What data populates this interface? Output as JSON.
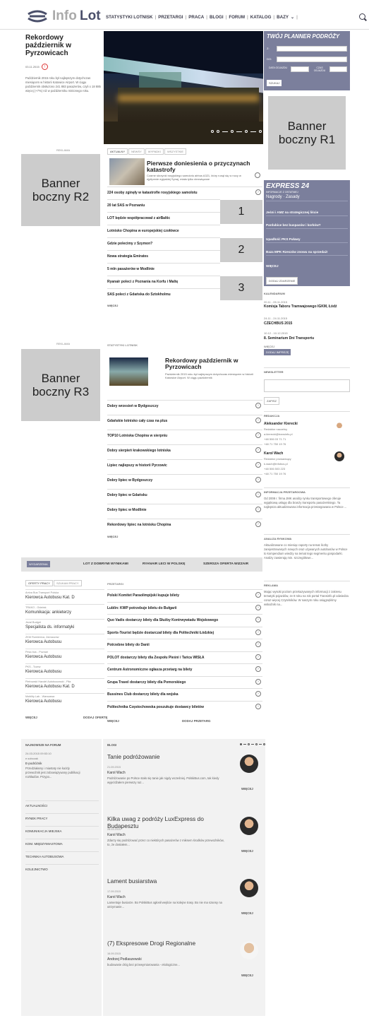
{
  "header": {
    "logo_info": "Info",
    "logo_lot": "Lot",
    "nav": [
      "STATYSTYKI LOTNISK",
      "PRZETARGI",
      "PRACA",
      "BLOGI",
      "FORUM",
      "KATALOG",
      "BAZY"
    ]
  },
  "featured": {
    "title": "Rekordowy październik w Pyrzowicach",
    "date": "03.11.2015",
    "excerpt": "Październik 2015 roku był najlepszym dotychczas miesiącem w historii Katowice Airport. W ciągu październik obsłużono 241 883 pasażerów, czyli o 18 885 więcej (+7%) niż w październiku minionego roku."
  },
  "planner": {
    "title": "TWÓJ PLANNER PODRÓŻY",
    "z": "Z:",
    "do": "DO:",
    "data_odj": "DATA ODJAZDU",
    "czas_odj": "CZAS ODJAZDU",
    "szukaj": "SZUKAJ"
  },
  "banners": {
    "r1": "Banner boczny R1",
    "r2": "Banner boczny R2",
    "r3": "Banner boczny R3",
    "reklama": "REKLAMA"
  },
  "news": {
    "tabs": [
      "AKTUALNY",
      "NEWSY",
      "WYPADKI",
      "WSZYSTKIE"
    ],
    "lead_title": "Pierwsze doniesienia o przyczynach katastrofy",
    "lead_ex": "Czarne skrzynki rosyjskiego samolotu airbus A321, który runął się w nocy w ejpitpenie egipskiej Synaj, miała tylko niezwiązane",
    "items": [
      "224 osoby zginęły w katastrofie rosyjskiego samolotu",
      "20 lat SAS w Poznaniu",
      "LOT będzie współpracował z airBaltic",
      "Lotnisko Chopina w europejskiej czołówce",
      "Gdzie polecimy z Szymon?",
      "Nowa strategia Emirates",
      "5 mln pasażerów w Modlinie",
      "Ryanair poleci z Poznania na Korfu i Maltę",
      "SAS poleci z Gdańska do Sztokholmu"
    ],
    "more": "WIĘCEJ",
    "nums": [
      "1",
      "2",
      "3"
    ]
  },
  "stats": {
    "label": "STATYSTYKI LOTNISK",
    "lead_title": "Rekordowy październik w Pyrzowicach",
    "lead_ex": "Październik 2015 roku był najlepszym dotychczas miesiącem w historii Katowice Airport. W ciągu październik",
    "items": [
      "Dobry wrzesień w Bydgoszczy",
      "Gdańskie lotnisko cały czas na plus",
      "TOP10 Lotniska Chopina w sierpniu",
      "Dobry sierpień krakowskiego lotniska",
      "Lipiec najlepszy w historii Pyrzowic",
      "Dobry lipiec w Bydgoszczy",
      "Dobry lipiec w Gdańsku",
      "Dobry lipiec w Modlinie",
      "Rekordowy lipiec na lotnisku Chopina"
    ],
    "more": "WIĘCEJ"
  },
  "express": {
    "title": "EXPRESS 24",
    "sub": "INFORMACJE Z OSTATNIEJ",
    "items": [
      "Nagrody · Zasady",
      "Jeśni i AMZ na strategicznej liście",
      "Pardubice bez buspasów i korków?",
      "Upadłość PKS Puławy",
      "Baza MPK Rzeszów znowu na sprzedaż!"
    ],
    "more": "WIĘCEJ",
    "add": "DODAJ ZDARZENIE"
  },
  "calendar": {
    "label": "KALENDARIUM",
    "events": [
      {
        "date": "20.11 - 05.11.2015",
        "name": "Komisja Taboru Tramwajowego IGKM, Łódź"
      },
      {
        "date": "24.11 - 24.11.2015",
        "name": "CZECHBUS 2015"
      },
      {
        "date": "10.12 - 10.12.2015",
        "name": "8. Seminarium Dni Transportu"
      }
    ],
    "more": "WIĘCEJ",
    "add": "DODAJ IMPREZĘ"
  },
  "newsletter": {
    "label": "NEWSLETTER",
    "btn": "ZAPISZ"
  },
  "redakcja": {
    "label": "REDAKCJA",
    "people": [
      {
        "name": "Aleksander Kierecki",
        "role": "Redaktor naczelny",
        "mail": "a.kierecki@transinfo.pl",
        "tel1": "+48 506 03 71 71",
        "tel2": "+48 71 750 19 76"
      },
      {
        "name": "Karol Wach",
        "role": "Redaktor prowadzący",
        "mail": "k.wach@infobus.pl",
        "tel1": "+48 506 503 223",
        "tel2": "+48 71 750 19 76"
      }
    ]
  },
  "info_przetarg": {
    "label": "INFORMACJA PRZETARGOWA",
    "text": "Od 2008 r. firma JMK analizy rynku transportowego oferuje wyjątkową usługę dla branży transportu pasażerskiego. Ta najlepsza aktualizowana informacja przetargowana w Polsce ..."
  },
  "analiza": {
    "label": "ANALIZA RYNKOWA",
    "text": "Aktualizowane co miesiąc raporty na temat liczby zarejestrowanych nowych oraz używanych autobusów w Polsce to kompendium wiedzy na temat tego segmentu gospodarki. Analizy zawierają min. szczegółowe..."
  },
  "reklama": {
    "label": "REKLAMA",
    "text": "Mając wysoki poziom przekazywanych informacji z zakresu tematyki pojazdów, ze 8 roku na rok portal Transinfo.pl odwiedza coraz więcej Czytelników. W naszym roku osiągnęliśmy wskaźnik na..."
  },
  "events_bar": {
    "label": "WYDARZENIA",
    "items": [
      "LOT Z DOBRYMI WYNIKAMI",
      "RYANAIR LECI W POLSKĘ",
      "SZERSZA OFERTA WIZZAIR"
    ]
  },
  "jobs": {
    "tabs": [
      "OFERTY PRACY",
      "SZUKAM PRACY"
    ],
    "items": [
      {
        "co": "Arriva Bus Transport Polska",
        "title": "Kierowca Autobusu Kat. D"
      },
      {
        "co": "TRAKO - Gdańsk",
        "title": "Komunikacja: ankieterzy"
      },
      {
        "co": "Jezal Budget",
        "title": "Specjalista ds. informatyki"
      },
      {
        "co": "ZKM Rumienica, Zamaczów",
        "title": "Kierowca Autobusu"
      },
      {
        "co": "Pesa bus - Poznań",
        "title": "Kierowca Autobusu"
      },
      {
        "co": "PKS - Tczew",
        "title": "Kierowca Autobusu"
      },
      {
        "co": "Pietrowski Handel Autobusowski - Piła",
        "title": "Kierowca Autobusu Kat. D"
      },
      {
        "co": "Mobility Lab - Warszawa",
        "title": "Kierowca Autobusu"
      }
    ],
    "more": "WIĘCEJ",
    "add": "DODAJ OFERTĘ"
  },
  "tenders": {
    "label": "PRZETARGI",
    "items": [
      "Polski Komitet Paraolimpijski kupuje bilety",
      "Lublin: KWP potrzebuje biletu do Bułgarii",
      "Quo Vadis dostarczy bilety dla Służby Kontrwywiadu Wojskowego",
      "Sports-Tourist będzie dostarczał bilety dla Politechniki Łódzkiej",
      "Potrzebne bilety do Danii",
      "POLOT dostarczy bilety dla Zespołu Pieśni i Tańca WISŁA",
      "Centrum Astronomiczne ogłasza przetarg na bilety",
      "Grupa Travel dostarczy bilety dla Pomorskiego",
      "Bussines Club dostarczy bilety dla wojska",
      "Politechnika Częstochowska poszukuje dostawcy biletów"
    ],
    "more": "WIĘCEJ",
    "add": "DODAJ PRZETARG"
  },
  "forum": {
    "label": "NAJNOWSZE NA FORUM",
    "date": "24.03.2015 09:53:10",
    "user": "e.sobczak",
    "cat": "E-podróżnik",
    "text": "Przedziałamy i miastaty nie każdy przewoźnik jest zobowiązywany publikacji rozkładów. Przypo...",
    "cats": [
      "AKTUALNOŚCI",
      "RYNEK PRACY",
      "KOMUNIKACJA MIEJSKA",
      "KOM. MIĘDZYMIASTOWA",
      "TECHNIKA AUTOBUSOWA",
      "KOLEJNICTWO"
    ]
  },
  "blogs": {
    "label": "BLOGI",
    "more": "WIĘCEJ",
    "items": [
      {
        "title": "Tanie podróżowanie",
        "date": "21.09.2015",
        "author": "Karol Wach",
        "ex": "Podróżowanie po Polsce stało się tanie jak nigdy wcześniej. PolskiBus.com, tak kiedy wyjeżdżałem pierwszy raz..."
      },
      {
        "title": "Kilka uwag z podróży LuxExpress do Budapesztu",
        "date": "28.03.2015",
        "author": "Karol Wach",
        "ex": "Zdarzy się podróżować przez co niektórych pasażerów z miksem środków przewoźników, to, że dostałem..."
      },
      {
        "title": "Lament busiarstwa",
        "date": "17.09.2015",
        "author": "Karol Wach",
        "ex": "Lamentuje busiarze. Bo PolskiBus ogłosił wejście na kolejne trasy. Bo nie ma szansy na utrzymanie..."
      },
      {
        "title": "(7) Ekspresowe Drogi Regionalne",
        "date": "16.09.2015",
        "author": "Andrzej Podlaszewski",
        "ex": "budowanie dróg bez przewymiarowania - ekologiczne..."
      }
    ]
  }
}
